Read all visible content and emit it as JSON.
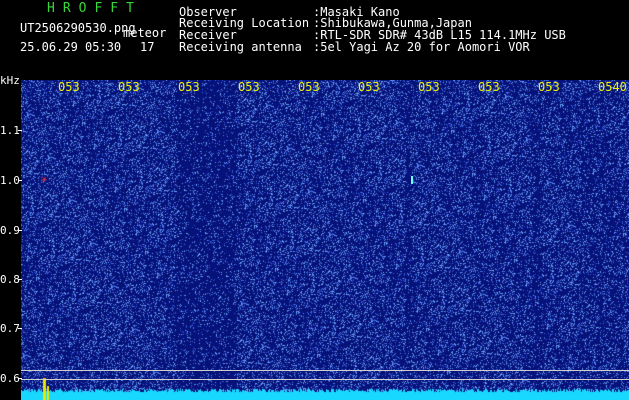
{
  "header": {
    "brand": "HROFFT",
    "file_name": "UT2506290530.png",
    "tag": "meteor",
    "date_time": "25.06.29 05:30",
    "count": "17",
    "info": [
      {
        "label": "Observer",
        "value": ":Masaki Kano"
      },
      {
        "label": "Receiving Location",
        "value": ":Shibukawa,Gunma,Japan"
      },
      {
        "label": "Receiver",
        "value": ":RTL-SDR SDR# 43dB L15 114.1MHz USB"
      },
      {
        "label": "Receiving antenna",
        "value": ":5el Yagi Az 20 for Aomori VOR"
      }
    ]
  },
  "axis": {
    "unit": "kHz",
    "y_ticks": [
      "1.1",
      "1.0",
      "0.9",
      "0.8",
      "0.7",
      "0.6"
    ],
    "x_ticks": [
      "053",
      "053",
      "053",
      "053",
      "053",
      "053",
      "053",
      "053",
      "053",
      "053",
      "0540"
    ]
  },
  "colors": {
    "background": "#000000",
    "plot_bg": "#06127a",
    "noise": "#5a78ff",
    "tick_label": "#f2f200",
    "brand": "#38d838",
    "signal": "#18d8ff"
  }
}
